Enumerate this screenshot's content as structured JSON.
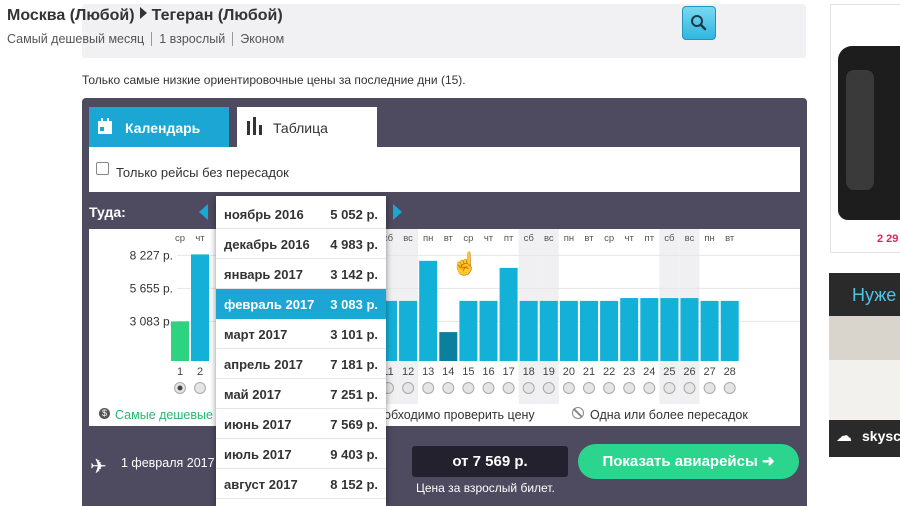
{
  "header": {
    "from": "Москва (Любой)",
    "to": "Тегеран (Любой)",
    "sub": [
      "Самый дешевый месяц",
      "1 взрослый",
      "Эконом"
    ]
  },
  "note": "Только самые низкие ориентировочные цены за последние дни (15).",
  "tabs": {
    "calendar": "Календарь",
    "table": "Таблица"
  },
  "filter": {
    "nonstop_label": "Только рейсы без пересадок",
    "checked": false
  },
  "direction_label": "Туда:",
  "months": [
    {
      "label": "ноябрь 2016",
      "price": "5 052 р."
    },
    {
      "label": "декабрь 2016",
      "price": "4 983 р."
    },
    {
      "label": "январь 2017",
      "price": "3 142 р."
    },
    {
      "label": "февраль 2017",
      "price": "3 083 р.",
      "selected": true
    },
    {
      "label": "март 2017",
      "price": "3 101 р."
    },
    {
      "label": "апрель 2017",
      "price": "7 181 р."
    },
    {
      "label": "май 2017",
      "price": "7 251 р."
    },
    {
      "label": "июнь 2017",
      "price": "7 569 р."
    },
    {
      "label": "июль 2017",
      "price": "9 403 р."
    },
    {
      "label": "август 2017",
      "price": "8 152 р."
    }
  ],
  "chart_data": {
    "type": "bar",
    "y_tick_labels": [
      "8 227 р.",
      "5 655 р.",
      "3 083 р."
    ],
    "y_ticks": [
      8227,
      5655,
      3083
    ],
    "visible_weekdays_left": [
      "ср",
      "чт"
    ],
    "x": [
      1,
      2,
      11,
      12,
      13,
      14,
      15,
      16,
      17,
      18,
      19,
      20,
      21,
      22,
      23,
      24,
      25,
      26,
      27,
      28
    ],
    "weekdays": [
      "ср",
      "чт",
      "сб",
      "вс",
      "пн",
      "вт",
      "ср",
      "чт",
      "пт",
      "сб",
      "вс",
      "пн",
      "вт",
      "ср",
      "чт",
      "пт",
      "сб",
      "вс",
      "пн",
      "вт"
    ],
    "values": [
      3083,
      8300,
      4680,
      4680,
      7800,
      2250,
      4680,
      4680,
      7250,
      4680,
      4680,
      4680,
      4680,
      4680,
      4900,
      4900,
      4900,
      4900,
      4680,
      4680
    ],
    "bar_status": [
      "cheapest",
      "normal",
      "normal",
      "normal",
      "normal",
      "selected",
      "normal",
      "normal",
      "normal",
      "normal",
      "normal",
      "normal",
      "normal",
      "normal",
      "normal",
      "normal",
      "normal",
      "normal",
      "normal",
      "normal"
    ],
    "weekend_days": [
      11,
      12,
      18,
      19,
      25,
      26
    ],
    "ylim": [
      0,
      9500
    ],
    "colors": {
      "cheapest": "#2ed37f",
      "normal": "#13b0d8",
      "selected": "#0b7f9e",
      "weekend": "#f0f0f2"
    }
  },
  "legend": {
    "cheapest": "Самые дешевые",
    "check": "обходимо проверить цену",
    "stops": "Одна или более пересадок"
  },
  "bottom": {
    "date": "1 февраля 2017",
    "price": "от 7 569 р.",
    "price_note": "Цена за взрослый билет.",
    "show_button": "Показать авиарейсы ➜"
  },
  "ads": {
    "price_fragment": "2 29",
    "banner_title": "Нуже",
    "banner_brand": "skysc"
  },
  "icons": {
    "search": "search-icon",
    "calendar": "calendar-icon",
    "table": "bar-chart-icon",
    "plane": "plane-icon",
    "cursor": "hand-pointer-icon"
  }
}
